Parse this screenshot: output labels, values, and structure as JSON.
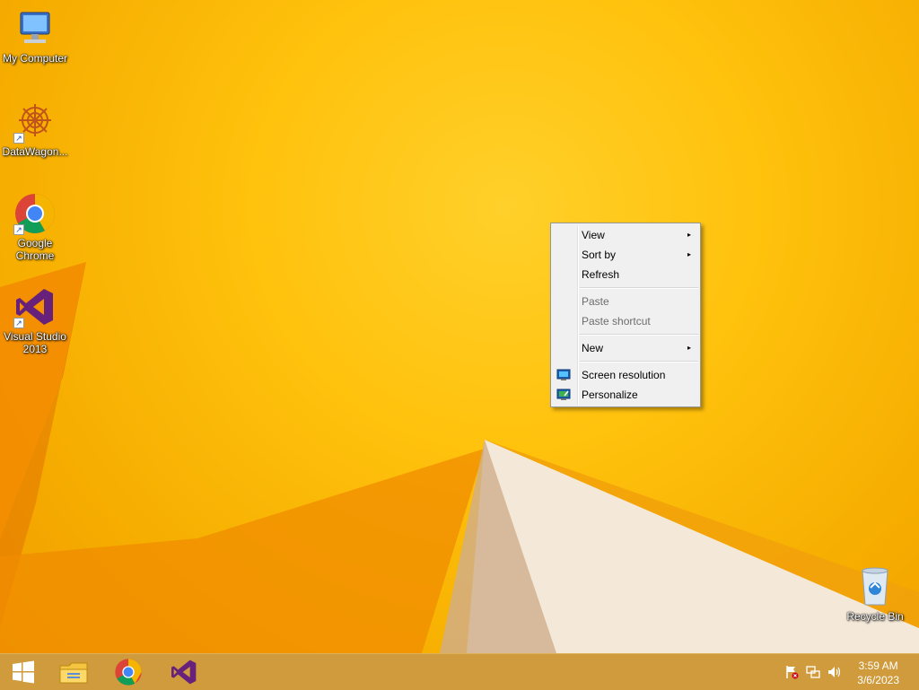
{
  "desktop": {
    "icons": [
      {
        "label": "My Computer"
      },
      {
        "label": "DataWagon..."
      },
      {
        "label": "Google Chrome"
      },
      {
        "label": "Visual Studio 2013"
      },
      {
        "label": "Recycle Bin"
      }
    ]
  },
  "context_menu": {
    "items": [
      {
        "label": "View",
        "submenu": true,
        "enabled": true
      },
      {
        "label": "Sort by",
        "submenu": true,
        "enabled": true
      },
      {
        "label": "Refresh",
        "enabled": true
      },
      {
        "label": "Paste",
        "enabled": false
      },
      {
        "label": "Paste shortcut",
        "enabled": false
      },
      {
        "label": "New",
        "submenu": true,
        "enabled": true
      },
      {
        "label": "Screen resolution",
        "enabled": true,
        "icon": "monitor-icon"
      },
      {
        "label": "Personalize",
        "enabled": true,
        "icon": "personalize-icon"
      }
    ],
    "submenu_glyph": "▸"
  },
  "taskbar": {
    "pinned": [
      "start-button",
      "file-explorer-icon",
      "chrome-icon",
      "visual-studio-icon"
    ],
    "clock": {
      "time": "3:59 AM",
      "date": "3/6/2023"
    }
  },
  "colors": {
    "wallpaper": "#f7b500",
    "taskbar": "#cf9b3c",
    "menu_bg": "#f0f0f0"
  }
}
